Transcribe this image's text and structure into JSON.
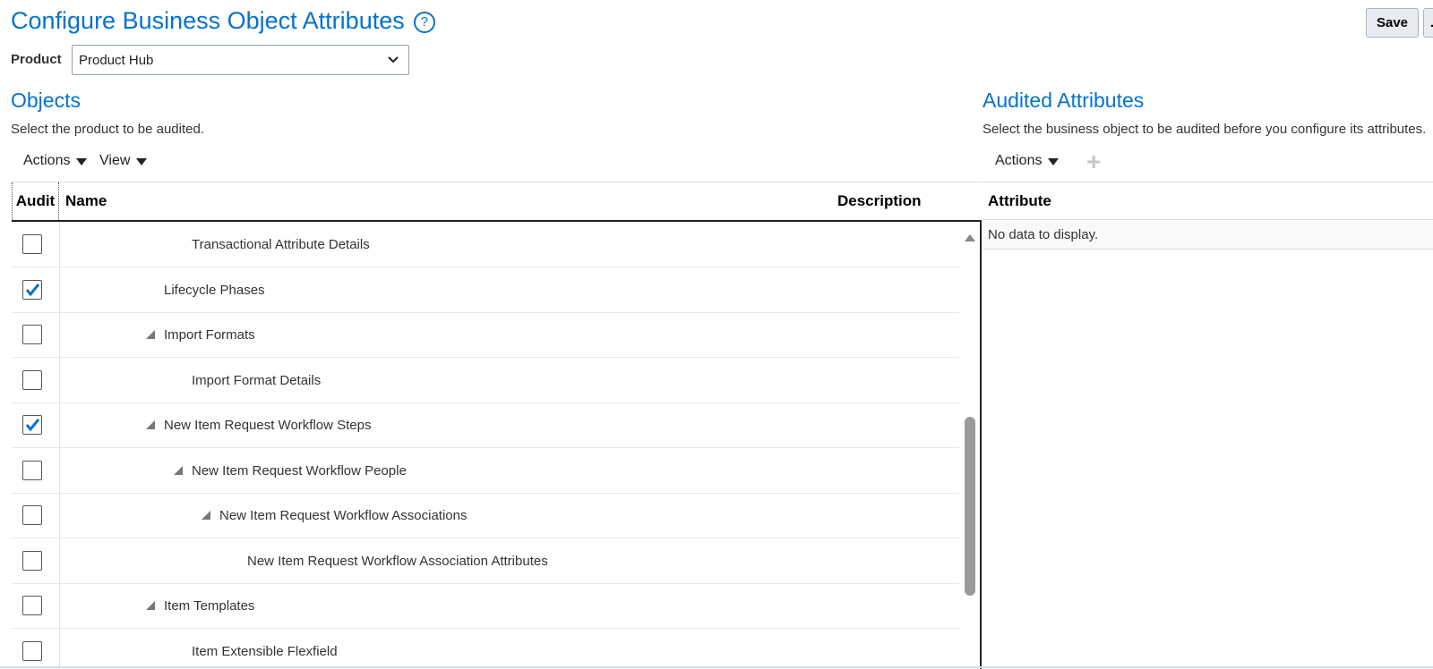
{
  "page": {
    "title": "Configure Business Object Attributes",
    "help_glyph": "?"
  },
  "toolbar": {
    "save_label": "Save",
    "second_button_label": "."
  },
  "product": {
    "label": "Product",
    "selected": "Product Hub"
  },
  "objects": {
    "heading": "Objects",
    "description": "Select the product to be audited.",
    "actions_label": "Actions",
    "view_label": "View",
    "columns": {
      "audit": "Audit",
      "name": "Name",
      "description": "Description"
    },
    "rows": [
      {
        "name": "Transactional Attribute Details",
        "checked": false,
        "expander": false,
        "indent": 2
      },
      {
        "name": "Lifecycle Phases",
        "checked": true,
        "expander": false,
        "indent": 1
      },
      {
        "name": "Import Formats",
        "checked": false,
        "expander": true,
        "indent": 1
      },
      {
        "name": "Import Format Details",
        "checked": false,
        "expander": false,
        "indent": 2
      },
      {
        "name": "New Item Request Workflow Steps",
        "checked": true,
        "expander": true,
        "indent": 1
      },
      {
        "name": "New Item Request Workflow People",
        "checked": false,
        "expander": true,
        "indent": 2
      },
      {
        "name": "New Item Request Workflow Associations",
        "checked": false,
        "expander": true,
        "indent": 3
      },
      {
        "name": "New Item Request Workflow Association Attributes",
        "checked": false,
        "expander": false,
        "indent": 4
      },
      {
        "name": "Item Templates",
        "checked": false,
        "expander": true,
        "indent": 1
      },
      {
        "name": "Item Extensible Flexfield",
        "checked": false,
        "expander": false,
        "indent": 2
      }
    ]
  },
  "audited": {
    "heading": "Audited Attributes",
    "description": "Select the business object to be audited before you configure its attributes.",
    "actions_label": "Actions",
    "column_attribute": "Attribute",
    "empty_text": "No data to display."
  },
  "icons": {
    "help": "help-icon",
    "dropdown": "chevron-down-icon",
    "expander": "expand-triangle-icon",
    "add": "plus-icon",
    "scroll_up": "scroll-up-icon"
  },
  "colors": {
    "accent": "#0572ce",
    "check": "#0572ce"
  }
}
